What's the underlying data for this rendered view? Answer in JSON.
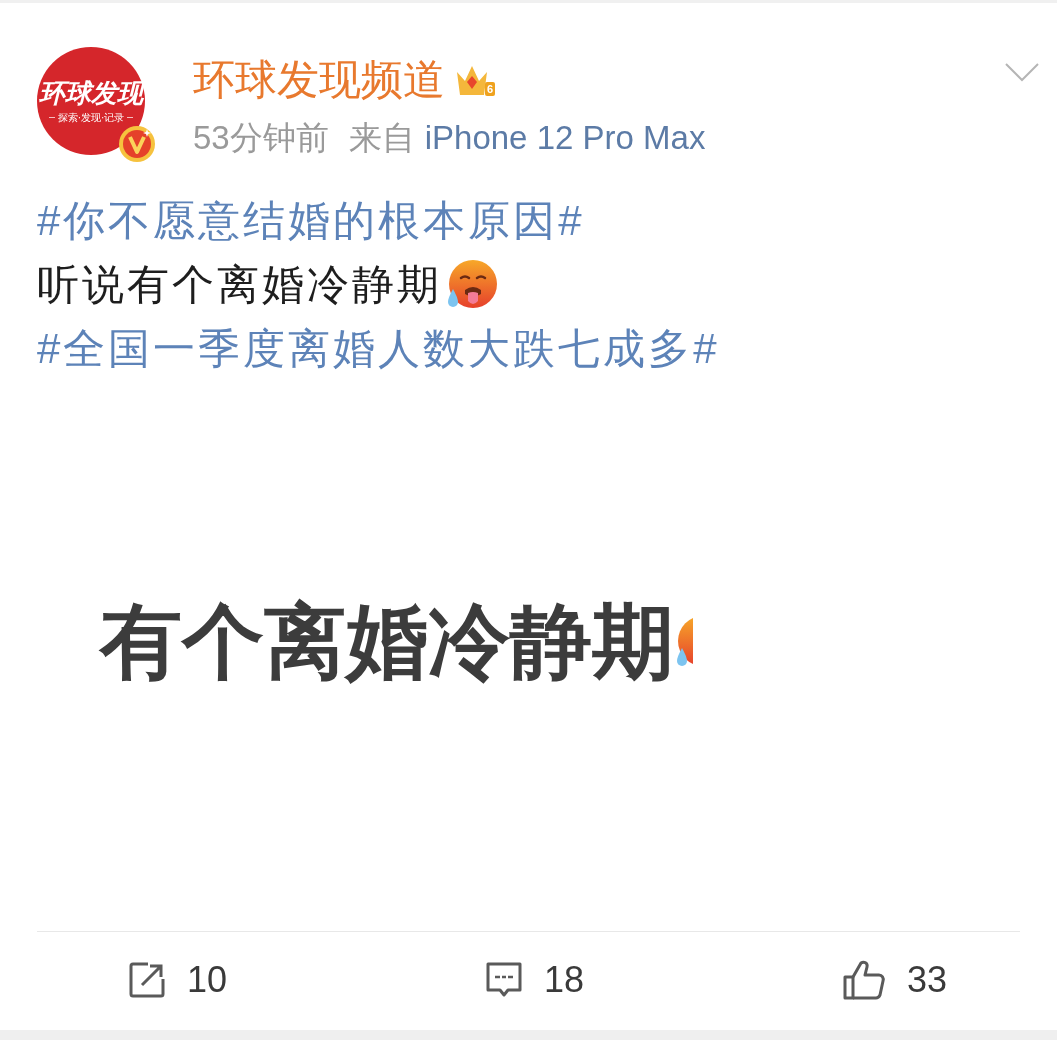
{
  "post": {
    "author": {
      "avatar": {
        "logo_text": "环球发现",
        "slogan": "探索·发现·记录",
        "verified": true
      },
      "name": "环球发现频道",
      "member_level": "6"
    },
    "meta": {
      "time": "53分钟前",
      "source_prefix": "来自",
      "source": "iPhone 12 Pro Max"
    },
    "body": [
      {
        "kind": "hashtag",
        "text": "#你不愿意结婚的根本原因#",
        "emoji": false
      },
      {
        "kind": "text",
        "text": "听说有个离婚冷静期",
        "emoji": true
      },
      {
        "kind": "hashtag",
        "text": "#全国一季度离婚人数大跌七成多#",
        "emoji": false
      }
    ],
    "image": {
      "text": "有个离婚冷静期",
      "emoji": true
    },
    "actions": [
      {
        "kind": "repost",
        "count": "10"
      },
      {
        "kind": "comment",
        "count": "18"
      },
      {
        "kind": "like",
        "count": "33"
      }
    ]
  }
}
